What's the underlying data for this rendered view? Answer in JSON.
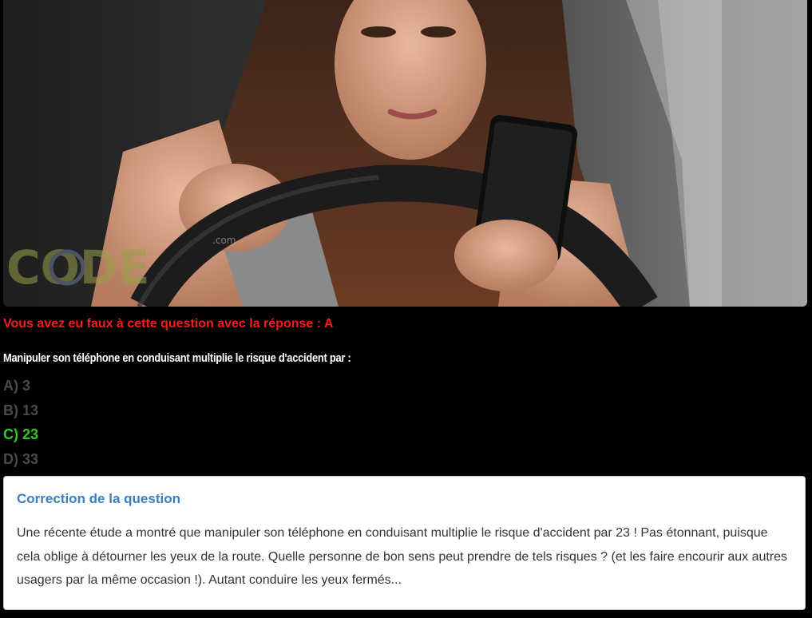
{
  "photo": {
    "alt": "Conductrice regardant son téléphone au volant",
    "watermark": "CODE",
    "watermark_suffix": ".com"
  },
  "result_message": "Vous avez eu faux à cette question avec la réponse : A",
  "question": "Manipuler son téléphone en conduisant multiplie le risque d'accident par :",
  "answers": [
    {
      "label": "A) 3",
      "correct": false
    },
    {
      "label": "B) 13",
      "correct": false
    },
    {
      "label": "C) 23",
      "correct": true
    },
    {
      "label": "D) 33",
      "correct": false
    }
  ],
  "correction": {
    "title": "Correction de la question",
    "text": "Une récente étude a montré que manipuler son téléphone en conduisant multiplie le risque d'accident par 23 ! Pas étonnant, puisque cela oblige à détourner les yeux de la route. Quelle personne de bon sens peut prendre de tels risques ? (et les faire encourir aux autres usagers par la même occasion !). Autant conduire les yeux fermés..."
  },
  "colors": {
    "wrong": "#ff1a1a",
    "correct": "#2ecc1f",
    "inactive_answer": "#4a4a4a",
    "correction_title": "#3a7fbf"
  }
}
